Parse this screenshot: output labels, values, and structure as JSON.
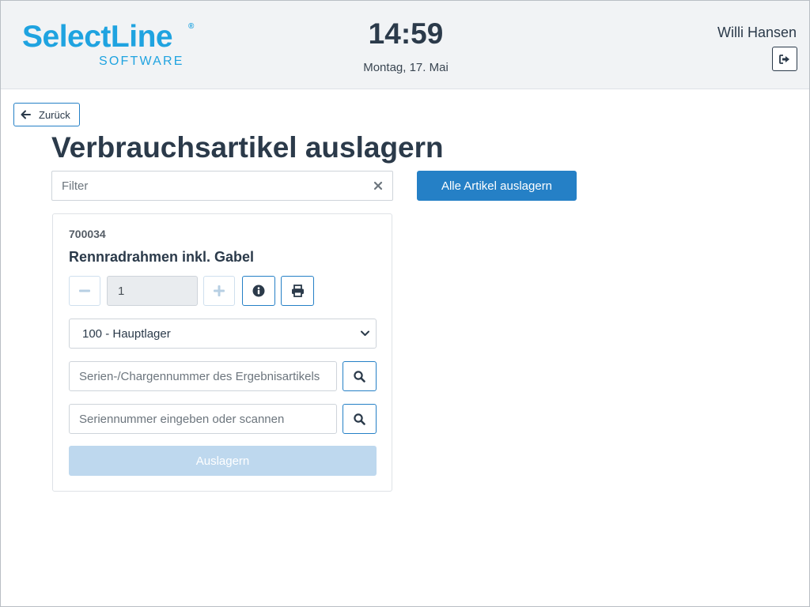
{
  "header": {
    "logo_main": "SelectLine",
    "logo_reg": "®",
    "logo_sub": "SOFTWARE",
    "time": "14:59",
    "date": "Montag, 17. Mai",
    "user_name": "Willi Hansen",
    "logout_icon": "sign-out-icon"
  },
  "nav": {
    "back_label": "Zurück",
    "back_icon": "arrow-left-icon"
  },
  "page": {
    "title": "Verbrauchsartikel auslagern",
    "filter_placeholder": "Filter",
    "filter_value": "",
    "all_button_label": "Alle Artikel auslagern"
  },
  "item": {
    "number": "700034",
    "name": "Rennradrahmen inkl. Gabel",
    "quantity": "1",
    "warehouse_selected": "100 - Hauptlager",
    "batch_placeholder": "Serien-/Chargennummer des Ergebnisartikels",
    "serial_placeholder": "Seriennummer eingeben oder scannen",
    "submit_label": "Auslagern",
    "submit_enabled": false
  },
  "colors": {
    "primary": "#2580c6",
    "brand": "#1fa3e0",
    "disabled": "#bed8ee",
    "text": "#2b3a4a"
  }
}
